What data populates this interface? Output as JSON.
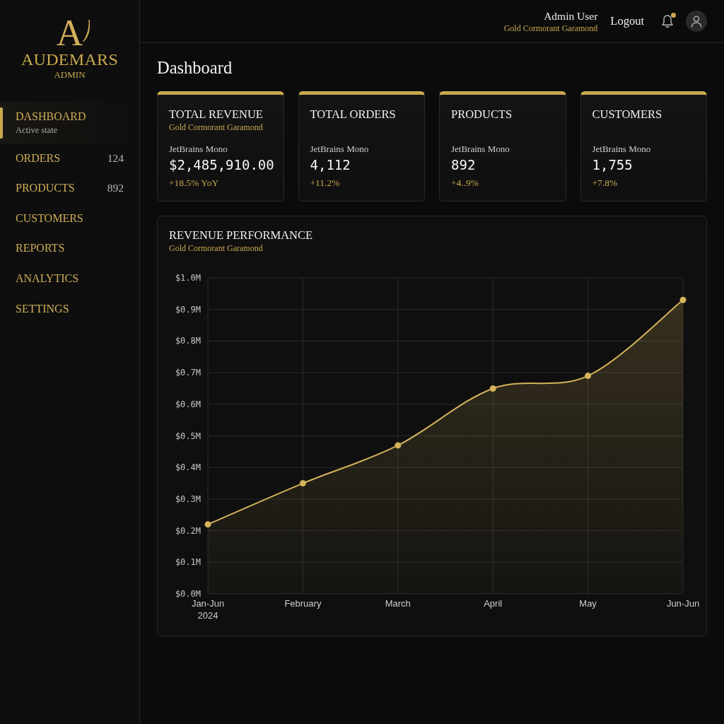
{
  "sidebar": {
    "logo": {
      "monogram": "A",
      "name": "AUDEMARS",
      "subtitle": "ADMIN"
    },
    "items": [
      {
        "label": "DASHBOARD",
        "note": "Active state",
        "selected": true
      },
      {
        "label": "ORDERS",
        "count": "124",
        "selected": false
      },
      {
        "label": "PRODUCTS",
        "count": "892",
        "selected": false
      },
      {
        "label": "CUSTOMERS",
        "selected": false
      },
      {
        "label": "REPORTS",
        "selected": false
      },
      {
        "label": "ANALYTICS",
        "selected": false
      },
      {
        "label": "SETTINGS",
        "selected": false
      }
    ]
  },
  "header": {
    "user": {
      "name": "Admin User",
      "subtitle": "Gold Cormorant Garamond"
    },
    "logout": "Logout",
    "notifications": {
      "unread": true
    }
  },
  "page_title": "Dashboard",
  "stats": [
    {
      "title": "TOTAL REVENUE",
      "subtitle": "Gold Cormorant Garamond",
      "caption": "JetBrains Mono",
      "value": "$2,485,910.00",
      "change": "+18.5% YoY"
    },
    {
      "title": "TOTAL ORDERS",
      "caption": "JetBrains Mono",
      "value": "4,112",
      "change": "+11.2%"
    },
    {
      "title": "PRODUCTS",
      "caption": "JetBrains Mono",
      "value": "892",
      "change": "+4..9%"
    },
    {
      "title": "CUSTOMERS",
      "caption": "JetBrains Mono",
      "value": "1,755",
      "change": "+7.8%"
    }
  ],
  "revenue_panel": {
    "subtitle": "Gold Cormorant Garamond",
    "chart_data": {
      "type": "area",
      "title": "REVENUE PERFORMANCE",
      "grid": true,
      "categories": [
        "Jan-Jun\n2024",
        "February",
        "March",
        "April",
        "May",
        "Jun-Jun"
      ],
      "series": [
        {
          "color": "#d4b35a",
          "values": [
            0.22,
            0.35,
            0.47,
            0.65,
            0.69,
            0.93
          ]
        }
      ],
      "ylim": [
        0,
        1.0
      ],
      "yticks": [
        {
          "value": 0,
          "label": "$0.0M"
        },
        {
          "value": 0.1,
          "label": "$0.1M"
        },
        {
          "value": 0.2,
          "label": "$0.2M"
        },
        {
          "value": 0.3,
          "label": "$0.3M"
        },
        {
          "value": 0.4,
          "label": "$0.4M"
        },
        {
          "value": 0.5,
          "label": "$0.5M"
        },
        {
          "value": 0.6,
          "label": "$0.6M"
        },
        {
          "value": 0.7,
          "label": "$0.7M"
        },
        {
          "value": 0.8,
          "label": "$0.8M"
        },
        {
          "value": 0.9,
          "label": "$0.9M"
        },
        {
          "value": 1.0,
          "label": "$1.0M"
        }
      ]
    }
  }
}
